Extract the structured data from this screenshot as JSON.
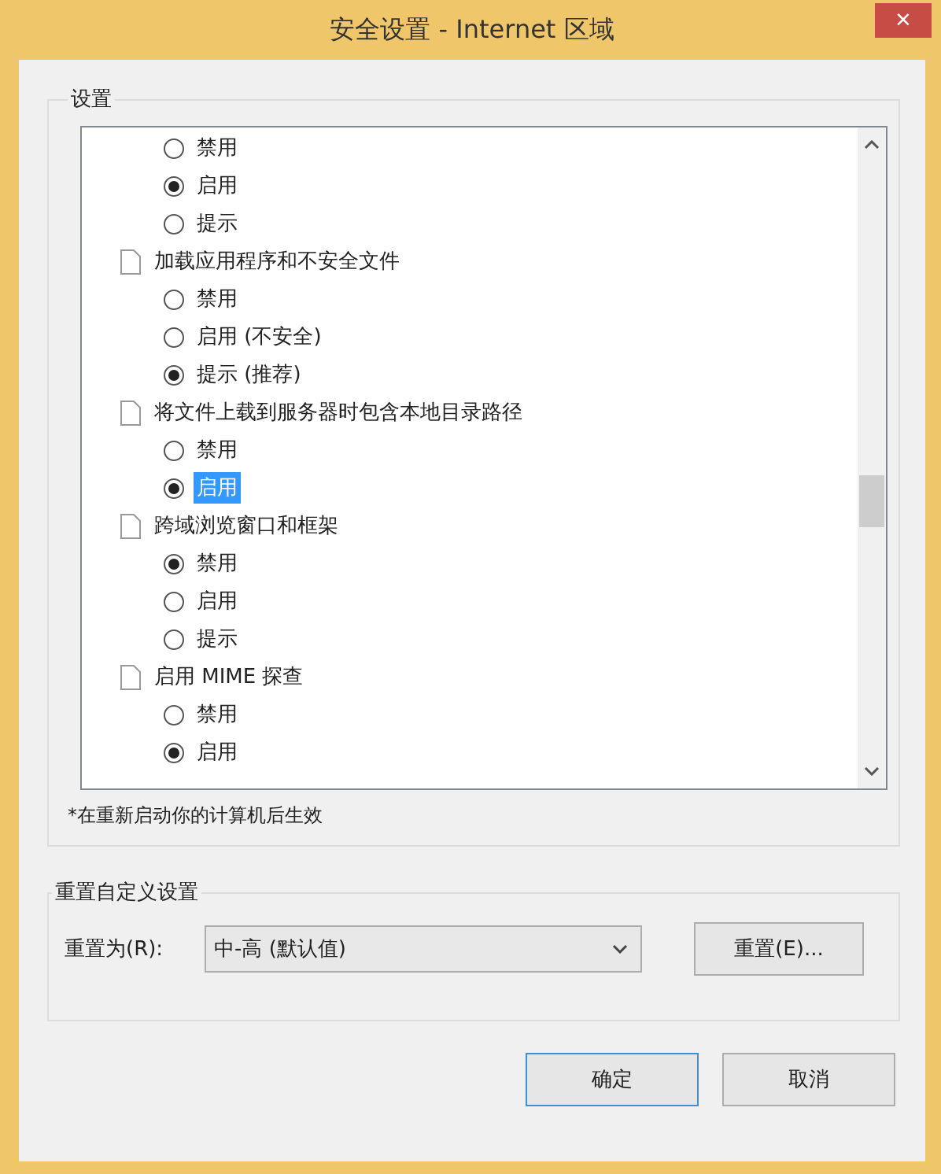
{
  "window": {
    "title": "安全设置 - Internet 区域",
    "close": "×"
  },
  "settings_group": {
    "title": "设置",
    "items": [
      {
        "options": [
          {
            "label": "禁用",
            "selected": false,
            "focused": false
          },
          {
            "label": "启用",
            "selected": true,
            "focused": false
          },
          {
            "label": "提示",
            "selected": false,
            "focused": false
          }
        ]
      },
      {
        "label": "加载应用程序和不安全文件",
        "options": [
          {
            "label": "禁用",
            "selected": false,
            "focused": false
          },
          {
            "label": "启用 (不安全)",
            "selected": false,
            "focused": false
          },
          {
            "label": "提示 (推荐)",
            "selected": true,
            "focused": false
          }
        ]
      },
      {
        "label": "将文件上载到服务器时包含本地目录路径",
        "options": [
          {
            "label": "禁用",
            "selected": false,
            "focused": false
          },
          {
            "label": "启用",
            "selected": true,
            "focused": true
          }
        ]
      },
      {
        "label": "跨域浏览窗口和框架",
        "options": [
          {
            "label": "禁用",
            "selected": true,
            "focused": false
          },
          {
            "label": "启用",
            "selected": false,
            "focused": false
          },
          {
            "label": "提示",
            "selected": false,
            "focused": false
          }
        ]
      },
      {
        "label": "启用 MIME 探查",
        "options": [
          {
            "label": "禁用",
            "selected": false,
            "focused": false
          },
          {
            "label": "启用",
            "selected": true,
            "focused": false
          }
        ]
      }
    ],
    "note": "*在重新启动你的计算机后生效"
  },
  "reset_group": {
    "title": "重置自定义设置",
    "label": "重置为(R):",
    "value": "中-高 (默认值)",
    "button": "重置(E)..."
  },
  "buttons": [
    {
      "label": "确定",
      "default": true
    },
    {
      "label": "取消",
      "default": false
    }
  ]
}
